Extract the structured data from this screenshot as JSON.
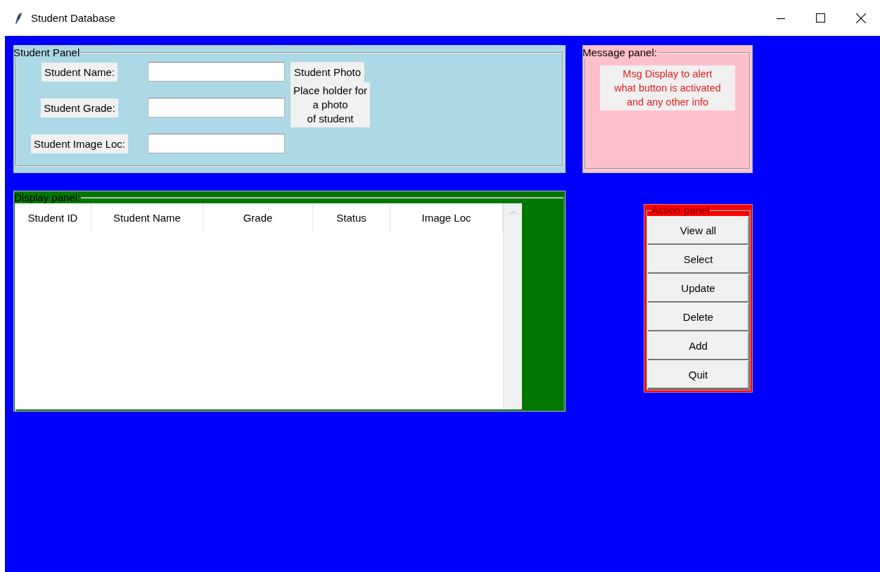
{
  "window": {
    "title": "Student Database"
  },
  "student_panel": {
    "title": "Student Panel",
    "fields": [
      {
        "label": "Student Name:"
      },
      {
        "label": "Student Grade:"
      },
      {
        "label": "Student Image Loc:"
      }
    ],
    "photo_title": "Student Photo",
    "photo_note": "Place holder for\na photo\nof student"
  },
  "message_panel": {
    "title": "Message panel:",
    "message": "Msg Display to alert\nwhat button is activated\nand any other info"
  },
  "display_panel": {
    "title": "Display panel:",
    "table": {
      "columns": [
        "Student ID",
        "Student Name",
        "Grade",
        "Status",
        "Image Loc"
      ]
    }
  },
  "action_panel": {
    "title": "Action panel",
    "buttons": [
      "View all",
      "Select",
      "Update",
      "Delete",
      "Add",
      "Quit"
    ]
  }
}
